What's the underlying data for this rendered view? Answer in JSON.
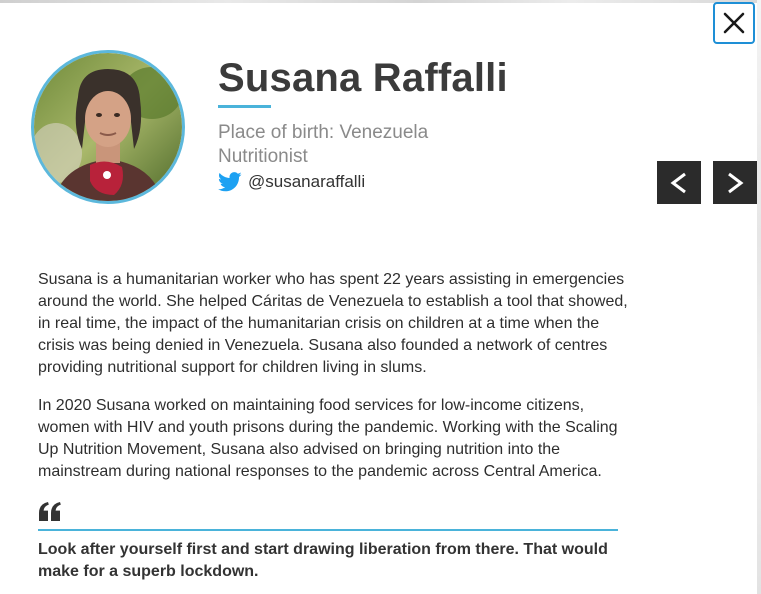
{
  "profile": {
    "name": "Susana Raffalli",
    "place_of_birth": "Place of birth: Venezuela",
    "occupation": "Nutritionist",
    "twitter_handle": "@susanaraffalli",
    "photo_alt": "Portrait of Susana Raffalli"
  },
  "bio": {
    "paragraph_1": "Susana is a humanitarian worker who has spent 22 years assisting in emergencies around the world. She helped Cáritas de Venezuela to establish a tool that showed, in real time, the impact of the humanitarian crisis on children at a time when the crisis was being denied in Venezuela. Susana also founded a network of centres providing nutritional support for children living in slums.",
    "paragraph_2": "In 2020 Susana worked on maintaining food services for low-income citizens, women with HIV and youth prisons during the pandemic. Working with the Scaling Up Nutrition Movement, Susana also advised on bringing nutrition into the mainstream during national responses to the pandemic across Central America."
  },
  "quote": {
    "text": "Look after yourself first and start drawing liberation from there. That would make for a superb lockdown."
  },
  "nav": {
    "prev_icon": "chevron-left-icon",
    "next_icon": "chevron-right-icon",
    "close_icon": "close-icon"
  },
  "colors": {
    "accent": "#4ab3da",
    "close_border": "#1e8fd6",
    "twitter_blue": "#1da1f2",
    "nav_bg": "#2b2b2b",
    "muted_text": "#8a8a8a"
  }
}
